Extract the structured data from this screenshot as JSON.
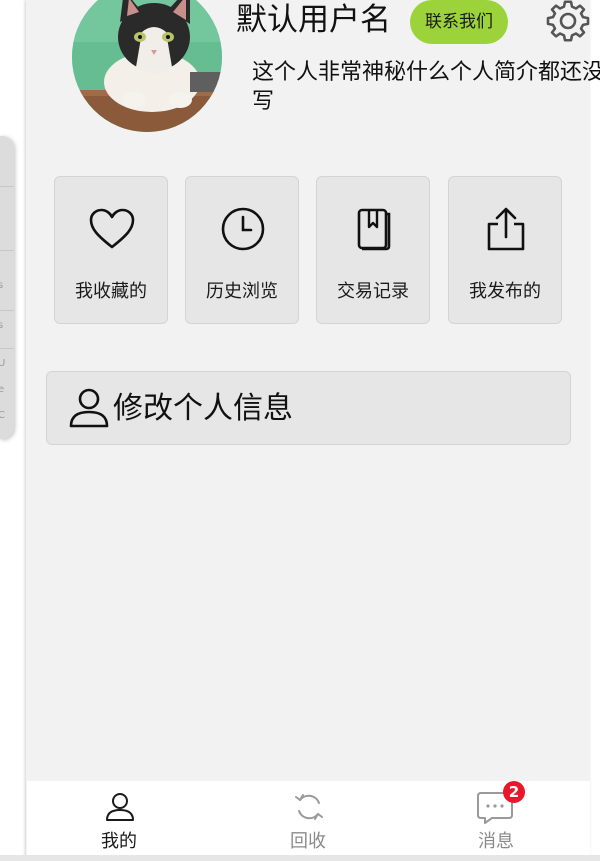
{
  "profile": {
    "username": "默认用户名",
    "contact_label": "联系我们",
    "bio": "这个人非常神秘什么个人简介都还没写"
  },
  "shortcuts": [
    {
      "label": "我收藏的",
      "icon": "heart-icon"
    },
    {
      "label": "历史浏览",
      "icon": "clock-icon"
    },
    {
      "label": "交易记录",
      "icon": "book-icon"
    },
    {
      "label": "我发布的",
      "icon": "share-icon"
    }
  ],
  "edit_profile": {
    "label": "修改个人信息",
    "icon": "user-icon"
  },
  "tabbar": {
    "tabs": [
      {
        "label": "我的",
        "icon": "user-icon",
        "active": true
      },
      {
        "label": "回收",
        "icon": "refresh-icon",
        "active": false
      },
      {
        "label": "消息",
        "icon": "chat-icon",
        "active": false
      }
    ],
    "badge": "2"
  },
  "left_edge_chars": [
    "s",
    "s",
    "U",
    "e",
    "C"
  ],
  "colors": {
    "accent_green": "#9cd33a",
    "badge_red": "#e8172c",
    "page_bg": "#f2f2f2",
    "tile_bg": "#e6e6e6",
    "active_text": "#1a1a1a",
    "inactive_text": "#8a8a8a"
  }
}
